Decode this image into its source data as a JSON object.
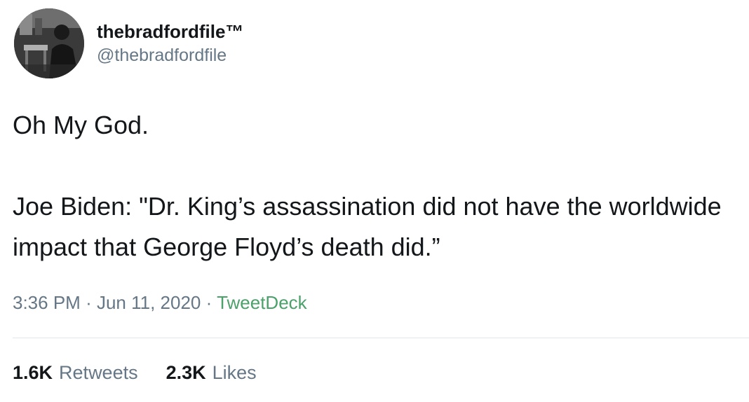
{
  "author": {
    "display_name": "thebradfordfile™",
    "handle": "@thebradfordfile"
  },
  "tweet": {
    "text": "Oh My God.\n\nJoe Biden: \"Dr. King’s assassination did not have the worldwide impact that George Floyd’s death did.”"
  },
  "meta": {
    "time": "3:36 PM",
    "date": "Jun 11, 2020",
    "separator": "·",
    "source": "TweetDeck"
  },
  "stats": {
    "retweets_count": "1.6K",
    "retweets_label": "Retweets",
    "likes_count": "2.3K",
    "likes_label": "Likes"
  },
  "colors": {
    "text": "#14171a",
    "secondary": "#657786",
    "source_link": "#4aa26a",
    "divider": "#e1e8ed"
  }
}
